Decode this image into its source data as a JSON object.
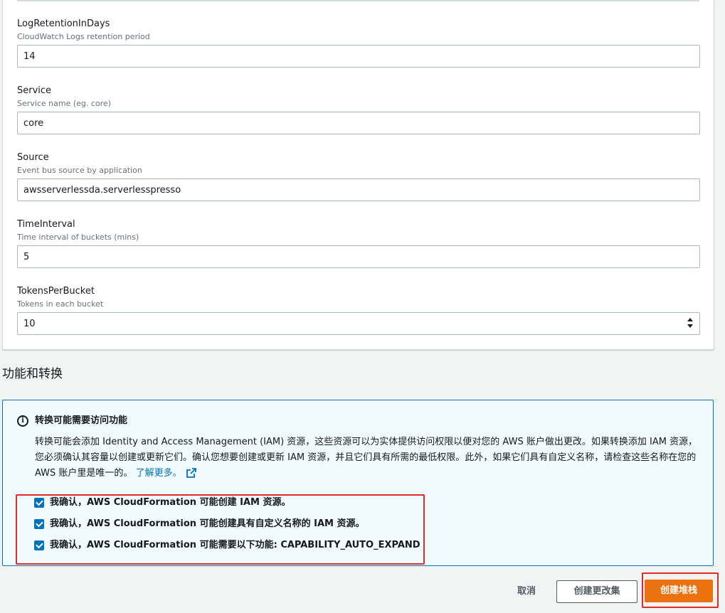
{
  "parameters": [
    {
      "label": "LogRetentionInDays",
      "description": "CloudWatch Logs retention period",
      "value": "14"
    },
    {
      "label": "Service",
      "description": "Service name (eg. core)",
      "value": "core"
    },
    {
      "label": "Source",
      "description": "Event bus source by application",
      "value": "awsserverlessda.serverlesspresso"
    },
    {
      "label": "TimeInterval",
      "description": "Time interval of buckets (mins)",
      "value": "5"
    },
    {
      "label": "TokensPerBucket",
      "description": "Tokens in each bucket",
      "value": "10"
    }
  ],
  "capabilities": {
    "section_title": "功能和转换",
    "info": {
      "icon": "info-icon",
      "title": "转换可能需要访问功能",
      "body": "转换可能会添加 Identity and Access Management (IAM) 资源，这些资源可以为实体提供访问权限以便对您的 AWS 账户做出更改。如果转换添加 IAM 资源，您必须确认其容量以创建或更新它们。确认您想要创建或更新 IAM 资源，并且它们具有所需的最低权限。此外，如果它们具有自定义名称，请检查这些名称在您的 AWS 账户里是唯一的。",
      "learn_more": "了解更多。"
    },
    "acknowledgements": [
      {
        "label": "我确认，AWS CloudFormation 可能创建 IAM 资源。",
        "checked": true
      },
      {
        "label": "我确认，AWS CloudFormation 可能创建具有自定义名称的 IAM 资源。",
        "checked": true
      },
      {
        "label": "我确认，AWS CloudFormation 可能需要以下功能: CAPABILITY_AUTO_EXPAND",
        "checked": true
      }
    ]
  },
  "footer": {
    "cancel": "取消",
    "create_change_set": "创建更改集",
    "create_stack": "创建堆栈"
  },
  "colors": {
    "primary": "#ec7211",
    "link": "#0073bb",
    "highlight": "#e02b27",
    "info_bg": "#f1faff"
  }
}
